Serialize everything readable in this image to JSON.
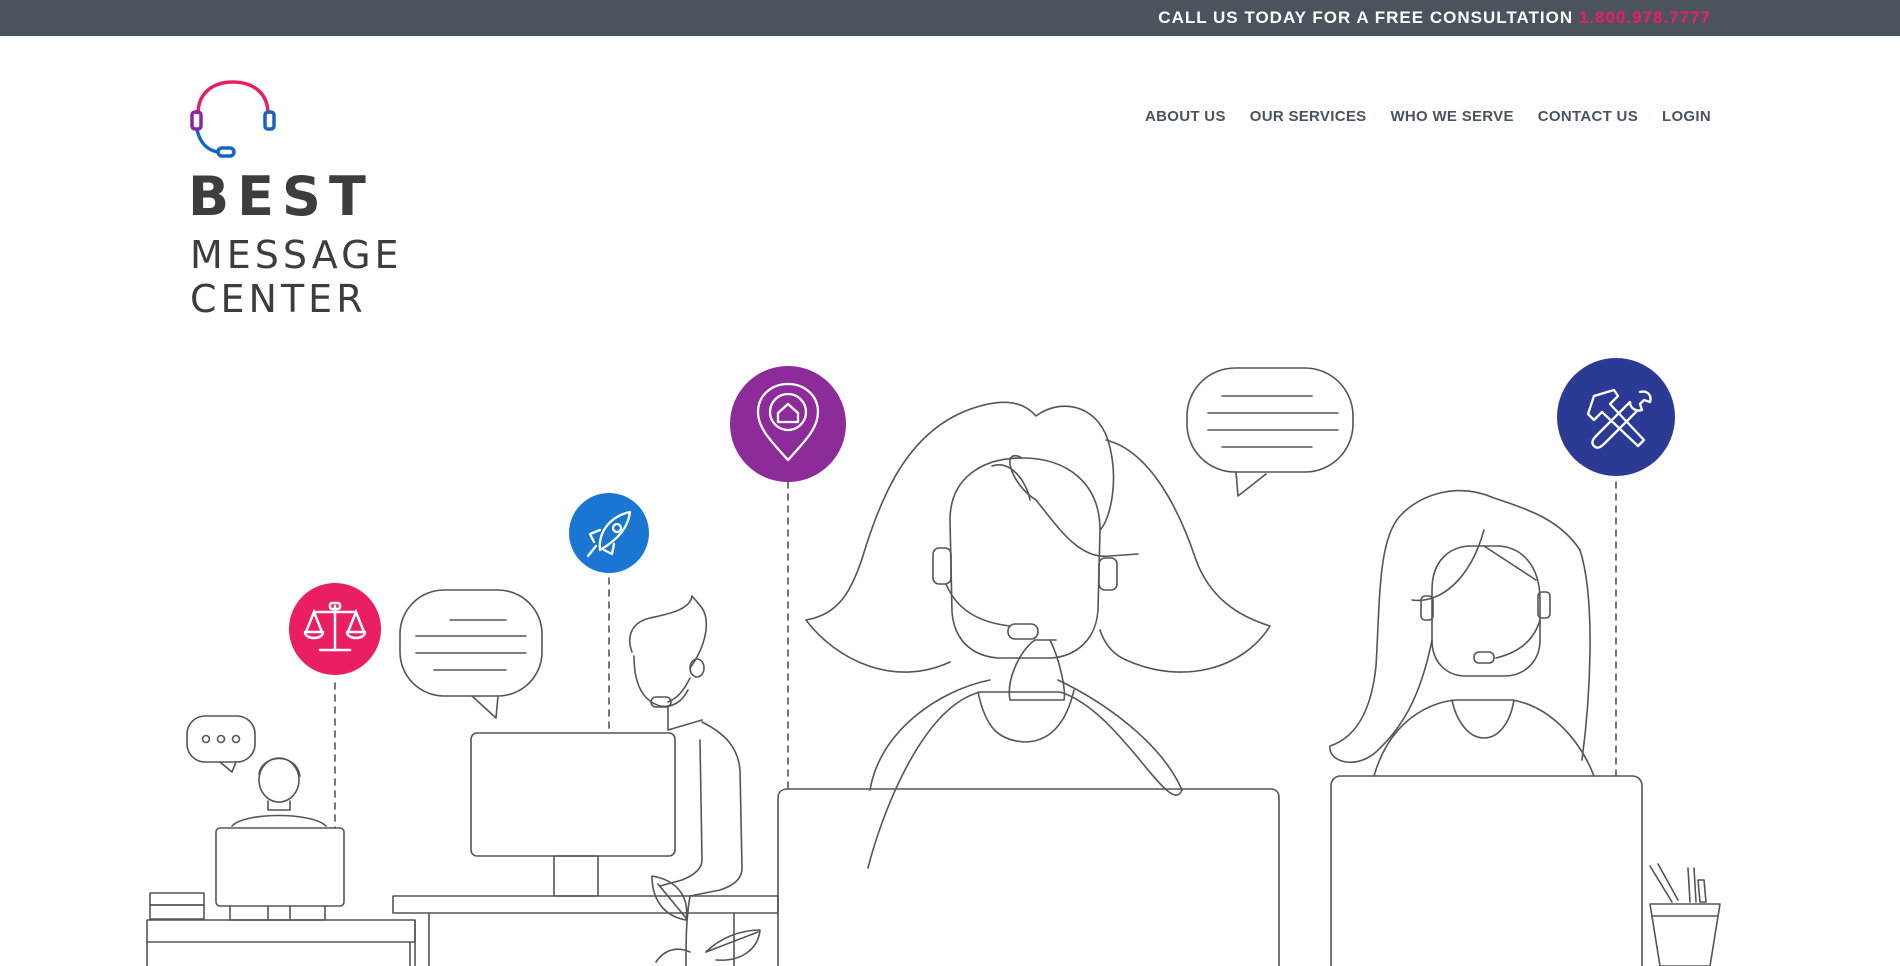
{
  "topbar": {
    "text": "CALL US TODAY FOR A FREE CONSULTATION",
    "phone": "1.800.978.7777",
    "background": "#4b545d",
    "phone_color": "#e91e63"
  },
  "logo": {
    "line1": "BEST",
    "line2": "MESSAGE",
    "line3": "CENTER",
    "icon": "headset-icon",
    "colors": [
      "#e91e63",
      "#8e24aa",
      "#1565c0"
    ]
  },
  "nav": {
    "items": [
      {
        "label": "ABOUT US"
      },
      {
        "label": "OUR SERVICES"
      },
      {
        "label": "WHO WE SERVE"
      },
      {
        "label": "CONTACT US"
      },
      {
        "label": "LOGIN"
      }
    ]
  },
  "hero": {
    "icons": [
      {
        "name": "scales-icon",
        "color": "#e91e63"
      },
      {
        "name": "rocket-icon",
        "color": "#1976d2"
      },
      {
        "name": "home-pin-icon",
        "color": "#8e2b9a"
      },
      {
        "name": "tools-icon",
        "color": "#2b3a94"
      }
    ],
    "line_color": "#555555"
  }
}
